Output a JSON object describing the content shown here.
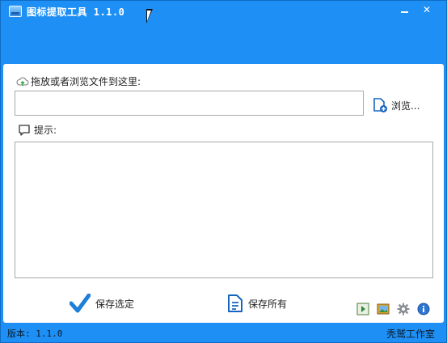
{
  "window": {
    "title": "图标提取工具 1.1.0",
    "minimize_label": "—",
    "close_label": "✕"
  },
  "drop_area": {
    "label": "拖放或者浏览文件到这里:",
    "path_value": "",
    "browse_label": "浏览..."
  },
  "hint": {
    "label": "提示:",
    "text": ""
  },
  "actions": {
    "save_selected_label": "保存选定",
    "save_all_label": "保存所有"
  },
  "toolbar": {
    "icons": [
      "play-icon",
      "image-icon",
      "settings-gear-icon",
      "info-icon"
    ]
  },
  "statusbar": {
    "version": "版本: 1.1.0",
    "studio": "秃鹫工作室"
  },
  "colors": {
    "frame": "#1e90f5",
    "check": "#1f7fd8",
    "icon_blue": "#1565c0"
  }
}
